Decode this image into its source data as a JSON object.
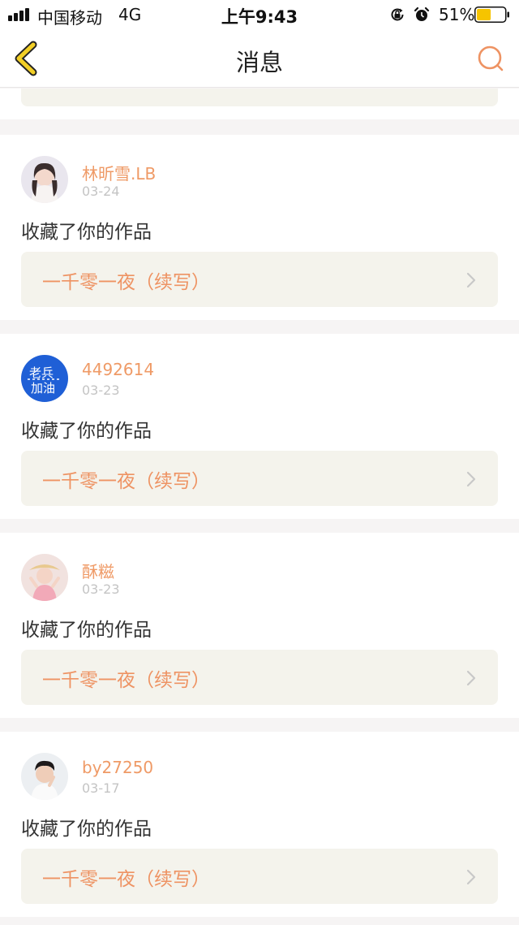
{
  "status_bar": {
    "carrier": "中国移动",
    "network": "4G",
    "time": "上午9:43",
    "battery_percent": "51%",
    "battery_level": 0.51,
    "icons": [
      "signal-icon",
      "orientation-lock-icon",
      "alarm-icon",
      "battery-icon"
    ]
  },
  "nav": {
    "title": "消息",
    "back_icon": "back-chevron-icon",
    "search_icon": "search-icon"
  },
  "colors": {
    "accent": "#ee9363",
    "username": "#ef9a66",
    "date": "#c4c4c4",
    "card_bg": "#f4f3ec",
    "back_icon": "#f2cf26"
  },
  "messages": [
    {
      "username": "林昕雪.LB",
      "date": "03-24",
      "action": "收藏了你的作品",
      "work_title": "一千零一夜（续写）",
      "avatar_icon": "user-avatar"
    },
    {
      "username": "4492614",
      "date": "03-23",
      "action": "收藏了你的作品",
      "work_title": "一千零一夜（续写）",
      "avatar_icon": "user-avatar"
    },
    {
      "username": "酥糍",
      "date": "03-23",
      "action": "收藏了你的作品",
      "work_title": "一千零一夜（续写）",
      "avatar_icon": "user-avatar"
    },
    {
      "username": "by27250",
      "date": "03-17",
      "action": "收藏了你的作品",
      "work_title": "一千零一夜（续写）",
      "avatar_icon": "user-avatar"
    }
  ]
}
